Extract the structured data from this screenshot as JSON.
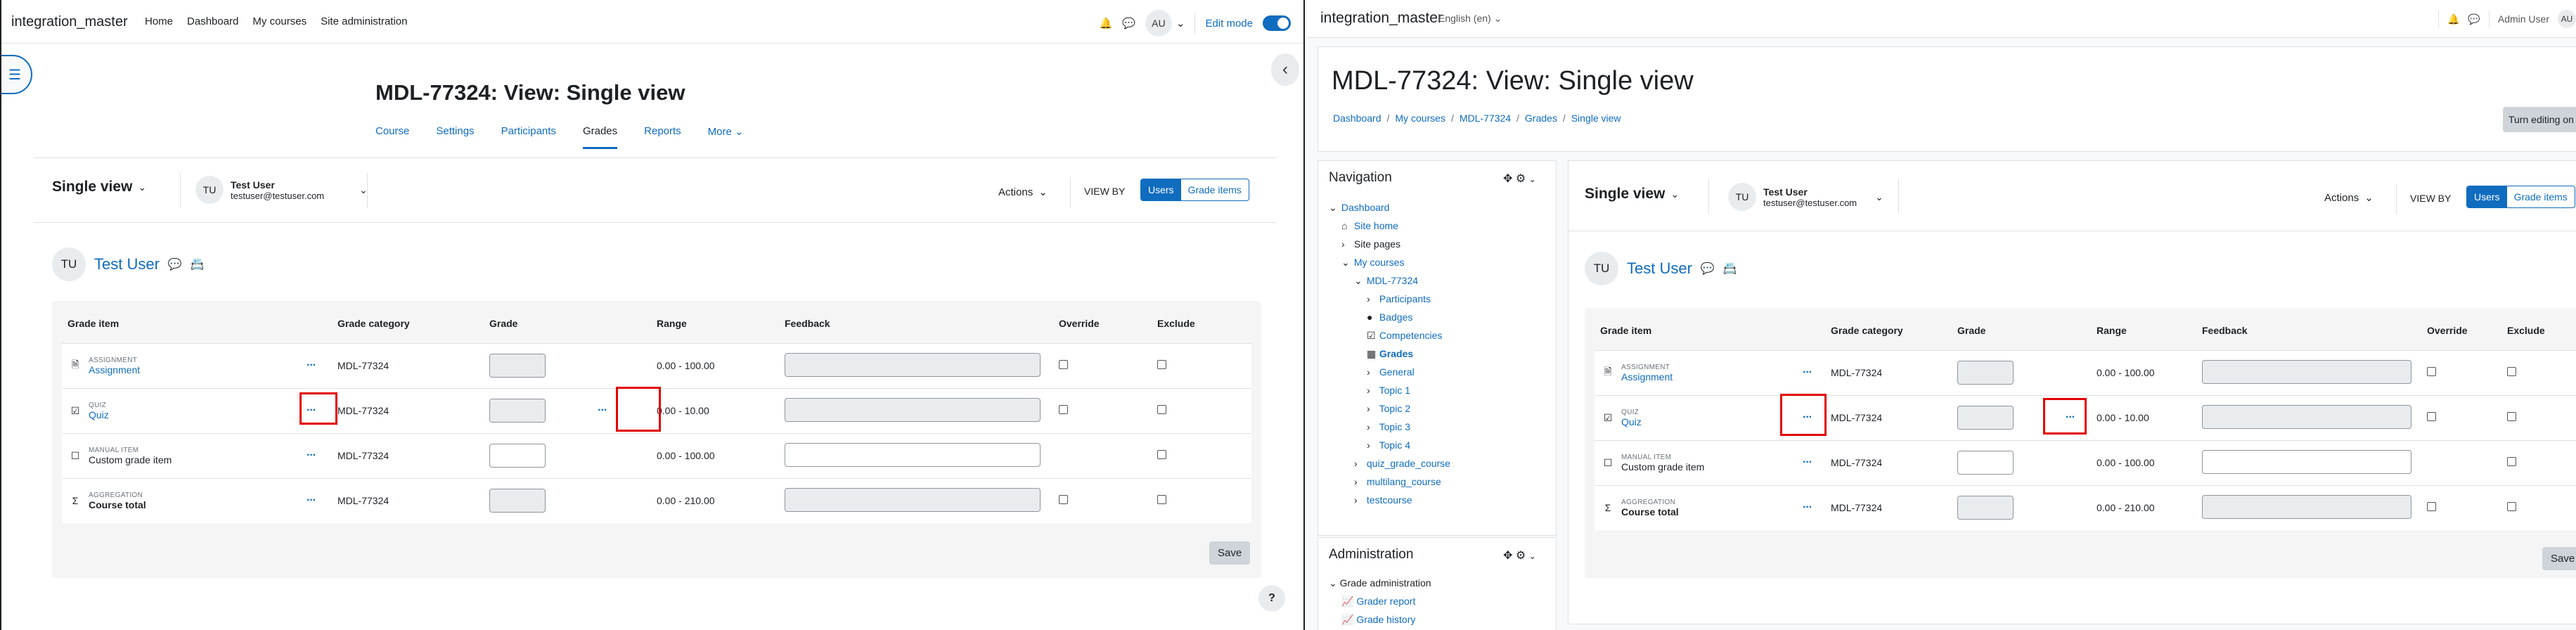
{
  "left": {
    "brand": "integration_master",
    "primary_nav": [
      "Home",
      "Dashboard",
      "My courses",
      "Site administration"
    ],
    "user_initials": "AU",
    "edit_mode_label": "Edit mode",
    "page_title": "MDL-77324: View: Single view",
    "secondary_nav": [
      "Course",
      "Settings",
      "Participants",
      "Grades",
      "Reports",
      "More"
    ],
    "active_tab": "Grades",
    "report_selector": "Single view",
    "selected_user": {
      "initials": "TU",
      "name": "Test User",
      "email": "testuser@testuser.com"
    },
    "actions_label": "Actions",
    "view_by_label": "VIEW BY",
    "view_by_options": [
      "Users",
      "Grade items"
    ],
    "heading_user": "Test User",
    "columns": [
      "Grade item",
      "Grade category",
      "Grade",
      "Range",
      "Feedback",
      "Override",
      "Exclude"
    ],
    "rows": [
      {
        "type": "ASSIGNMENT",
        "name": "Assignment",
        "category": "MDL-77324",
        "range": "0.00 - 100.00",
        "link": true,
        "bold": false
      },
      {
        "type": "QUIZ",
        "name": "Quiz",
        "category": "MDL-77324",
        "range": "0.00 - 10.00",
        "link": true,
        "bold": false
      },
      {
        "type": "MANUAL ITEM",
        "name": "Custom grade item",
        "category": "MDL-77324",
        "range": "0.00 - 100.00",
        "link": false,
        "bold": false
      },
      {
        "type": "AGGREGATION",
        "name": "Course total",
        "category": "MDL-77324",
        "range": "0.00 - 210.00",
        "link": false,
        "bold": true
      }
    ],
    "save_label": "Save",
    "help_label": "?"
  },
  "right": {
    "brand": "integration_master",
    "language": "English (en)",
    "user_label": "Admin User",
    "user_initials": "AU",
    "page_title": "MDL-77324: View: Single view",
    "breadcrumb": [
      "Dashboard",
      "My courses",
      "MDL-77324",
      "Grades",
      "Single view"
    ],
    "turn_editing": "Turn editing on",
    "navigation_title": "Navigation",
    "nav_tree": [
      {
        "label": "Dashboard",
        "depth": 0,
        "link": true,
        "bold": false
      },
      {
        "label": "Site home",
        "depth": 1,
        "link": true,
        "bold": false
      },
      {
        "label": "Site pages",
        "depth": 1,
        "link": false,
        "bold": false
      },
      {
        "label": "My courses",
        "depth": 1,
        "link": true,
        "bold": false
      },
      {
        "label": "MDL-77324",
        "depth": 2,
        "link": true,
        "bold": false
      },
      {
        "label": "Participants",
        "depth": 3,
        "link": true,
        "bold": false
      },
      {
        "label": "Badges",
        "depth": 3,
        "link": true,
        "bold": false
      },
      {
        "label": "Competencies",
        "depth": 3,
        "link": true,
        "bold": false
      },
      {
        "label": "Grades",
        "depth": 3,
        "link": true,
        "bold": true
      },
      {
        "label": "General",
        "depth": 3,
        "link": true,
        "bold": false
      },
      {
        "label": "Topic 1",
        "depth": 3,
        "link": true,
        "bold": false
      },
      {
        "label": "Topic 2",
        "depth": 3,
        "link": true,
        "bold": false
      },
      {
        "label": "Topic 3",
        "depth": 3,
        "link": true,
        "bold": false
      },
      {
        "label": "Topic 4",
        "depth": 3,
        "link": true,
        "bold": false
      },
      {
        "label": "quiz_grade_course",
        "depth": 2,
        "link": true,
        "bold": false
      },
      {
        "label": "multilang_course",
        "depth": 2,
        "link": true,
        "bold": false
      },
      {
        "label": "testcourse",
        "depth": 2,
        "link": true,
        "bold": false
      }
    ],
    "administration_title": "Administration",
    "admin_tree": [
      "Grade administration",
      "Grader report",
      "Grade history"
    ],
    "report_selector": "Single view",
    "selected_user": {
      "initials": "TU",
      "name": "Test User",
      "email": "testuser@testuser.com"
    },
    "actions_label": "Actions",
    "view_by_label": "VIEW BY",
    "view_by_options": [
      "Users",
      "Grade items"
    ],
    "heading_user": "Test User",
    "columns": [
      "Grade item",
      "Grade category",
      "Grade",
      "Range",
      "Feedback",
      "Override",
      "Exclude"
    ],
    "rows": [
      {
        "type": "ASSIGNMENT",
        "name": "Assignment",
        "category": "MDL-77324",
        "range": "0.00 - 100.00",
        "link": true,
        "bold": false
      },
      {
        "type": "QUIZ",
        "name": "Quiz",
        "category": "MDL-77324",
        "range": "0.00 - 10.00",
        "link": true,
        "bold": false
      },
      {
        "type": "MANUAL ITEM",
        "name": "Custom grade item",
        "category": "MDL-77324",
        "range": "0.00 - 100.00",
        "link": false,
        "bold": false
      },
      {
        "type": "AGGREGATION",
        "name": "Course total",
        "category": "MDL-77324",
        "range": "0.00 - 210.00",
        "link": false,
        "bold": true
      }
    ],
    "save_label": "Save"
  },
  "colors": {
    "link": "#0f6cbf",
    "highlight": "#e10000"
  }
}
